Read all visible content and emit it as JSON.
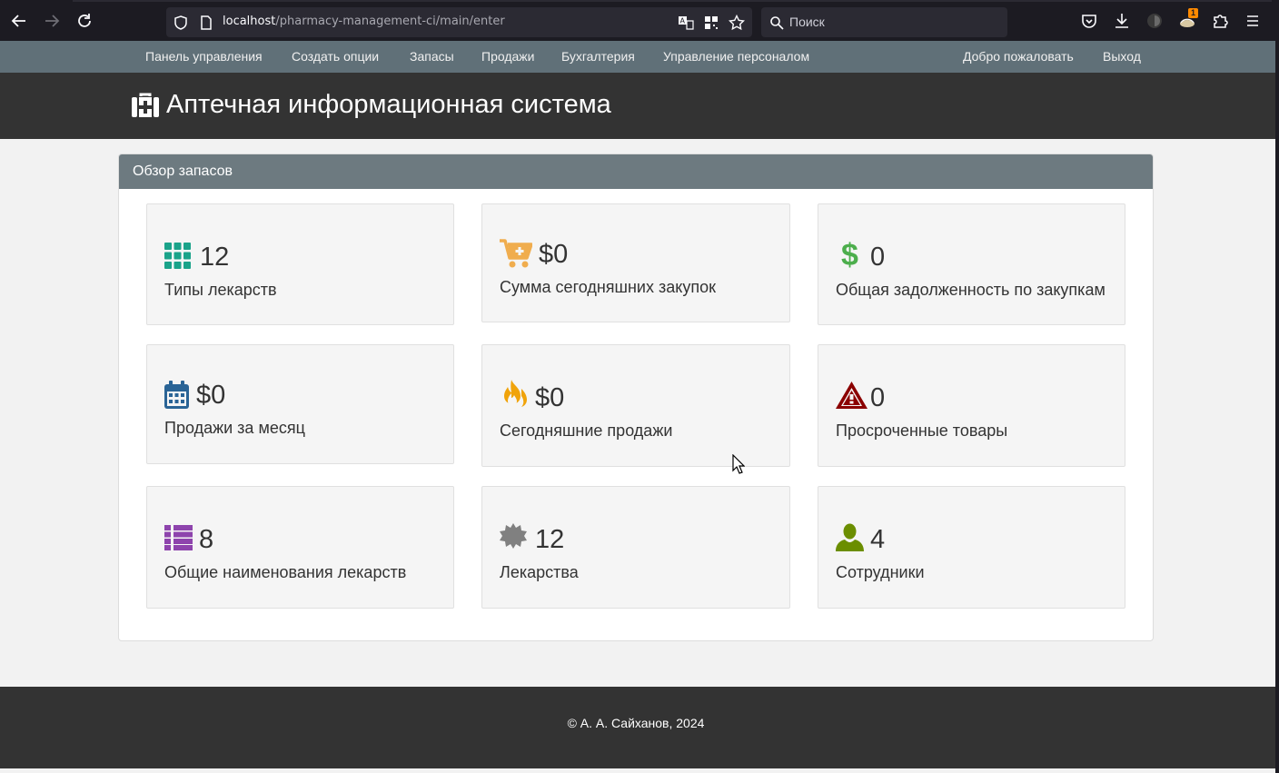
{
  "browser": {
    "url_host": "localhost",
    "url_path": "/pharmacy-management-ci/main/enter",
    "search_placeholder": "Поиск",
    "extension_badge": "1"
  },
  "nav": {
    "items": [
      {
        "label": "Панель управления"
      },
      {
        "label": "Создать опции"
      },
      {
        "label": "Запасы"
      },
      {
        "label": "Продажи"
      },
      {
        "label": "Бухгалтерия"
      },
      {
        "label": "Управление персоналом"
      }
    ],
    "welcome": "Добро пожаловать",
    "logout": "Выход"
  },
  "header": {
    "title": "Аптечная информационная система"
  },
  "panel": {
    "title": "Обзор запасов",
    "cards": [
      {
        "icon": "grid-icon",
        "value": "12",
        "label": "Типы лекарств",
        "color": "#1aa38a"
      },
      {
        "icon": "cart-plus-icon",
        "value": "$0",
        "label": "Сумма сегодняшних закупок",
        "color": "#f0ad4e"
      },
      {
        "icon": "dollar-icon",
        "value": "0",
        "label": "Общая задолженность по закупкам",
        "color": "#4cae4c"
      },
      {
        "icon": "calendar-icon",
        "value": "$0",
        "label": "Продажи за месяц",
        "color": "#2a6496"
      },
      {
        "icon": "fire-icon",
        "value": "$0",
        "label": "Сегодняшние продажи",
        "color": "#f0a30a"
      },
      {
        "icon": "warning-icon",
        "value": "0",
        "label": "Просроченные товары",
        "color": "#8b0000"
      },
      {
        "icon": "list-icon",
        "value": "8",
        "label": "Общие наименования лекарств",
        "color": "#8e44ad"
      },
      {
        "icon": "certificate-icon",
        "value": "12",
        "label": "Лекарства",
        "color": "#808080"
      },
      {
        "icon": "user-icon",
        "value": "4",
        "label": "Сотрудники",
        "color": "#6b8e00"
      }
    ]
  },
  "footer": {
    "text": "© А. А. Сайханов, 2024"
  }
}
